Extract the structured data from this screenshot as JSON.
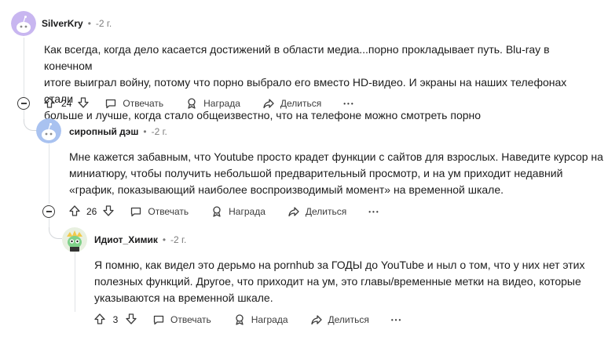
{
  "comments": [
    {
      "author": "SilverKry",
      "separator": "•",
      "time": "-2 г.",
      "text_lines": [
        "Как всегда, когда дело касается достижений в области медиа...порно прокладывает путь. Blu-ray в конечном",
        "итоге выиграл войну, потому что порно выбрало его вместо HD-видео. И экраны на наших телефонах стали",
        "больше и лучше, когда стало общеизвестно, что на телефоне можно смотреть порно"
      ],
      "votes": "24",
      "reply_label": "Отвечать",
      "award_label": "Награда",
      "share_label": "Делиться",
      "more_label": "•••"
    },
    {
      "author": "сиропный дэш",
      "separator": "•",
      "time": "-2 г.",
      "text_lines": [
        "Мне кажется забавным, что Youtube просто крадет функции с сайтов для взрослых. Наведите курсор на",
        "миниатюру, чтобы получить небольшой предварительный просмотр, и на ум приходит недавний",
        "«график, показывающий наиболее воспроизводимый момент» на временной шкале."
      ],
      "votes": "26",
      "reply_label": "Отвечать",
      "award_label": "Награда",
      "share_label": "Делиться",
      "more_label": "•••"
    },
    {
      "author": "Идиот_Химик",
      "separator": "•",
      "time": "-2 г.",
      "text_lines": [
        "Я помню, как видел это дерьмо на pornhub за ГОДЫ до YouTube и ныл о том, что у них нет этих",
        "полезных функций. Другое, что приходит на ум, это главы/временные метки на видео, которые",
        "указываются на временной шкале."
      ],
      "votes": "3",
      "reply_label": "Отвечать",
      "award_label": "Награда",
      "share_label": "Делиться",
      "more_label": "•••"
    }
  ],
  "colors": {
    "avatar1": "#c8b6f0",
    "avatar2": "#a9c2f0",
    "avatar3": "#e8f0e0",
    "text": "#1c1c1c",
    "muted": "#7c7c7c"
  }
}
